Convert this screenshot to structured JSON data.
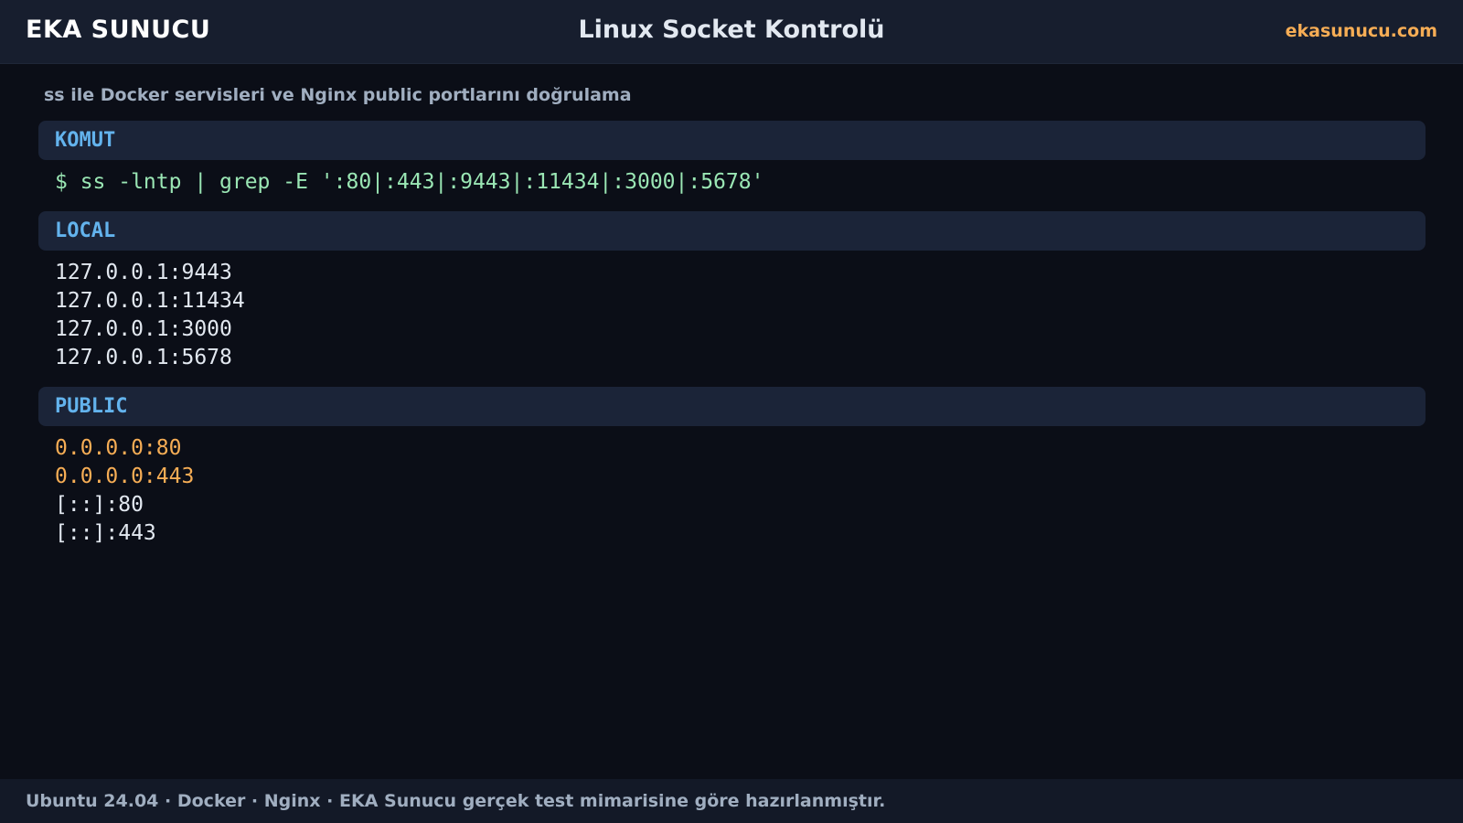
{
  "header": {
    "brand": "EKA SUNUCU",
    "title": "Linux Socket Kontrolü",
    "site": "ekasunucu.com"
  },
  "subtitle": "ss ile Docker servisleri ve Nginx public portlarını doğrulama",
  "sections": {
    "command": {
      "title": "KOMUT",
      "line": "$ ss -lntp | grep -E ':80|:443|:9443|:11434|:3000|:5678'"
    },
    "local": {
      "title": "LOCAL",
      "lines": [
        "127.0.0.1:9443",
        "127.0.0.1:11434",
        "127.0.0.1:3000",
        "127.0.0.1:5678"
      ]
    },
    "public": {
      "title": "PUBLIC",
      "lines": [
        "0.0.0.0:80",
        "0.0.0.0:443",
        "[::]:80",
        "[::]:443"
      ]
    }
  },
  "footer": {
    "text": "Ubuntu 24.04 · Docker · Nginx · EKA Sunucu gerçek test mimarisine göre hazırlanmıştır."
  },
  "colors": {
    "background": "#0b0e17",
    "accent_orange": "#f6ad55",
    "section_title_blue": "#63b3ed",
    "command_green": "#9ae6b4"
  }
}
